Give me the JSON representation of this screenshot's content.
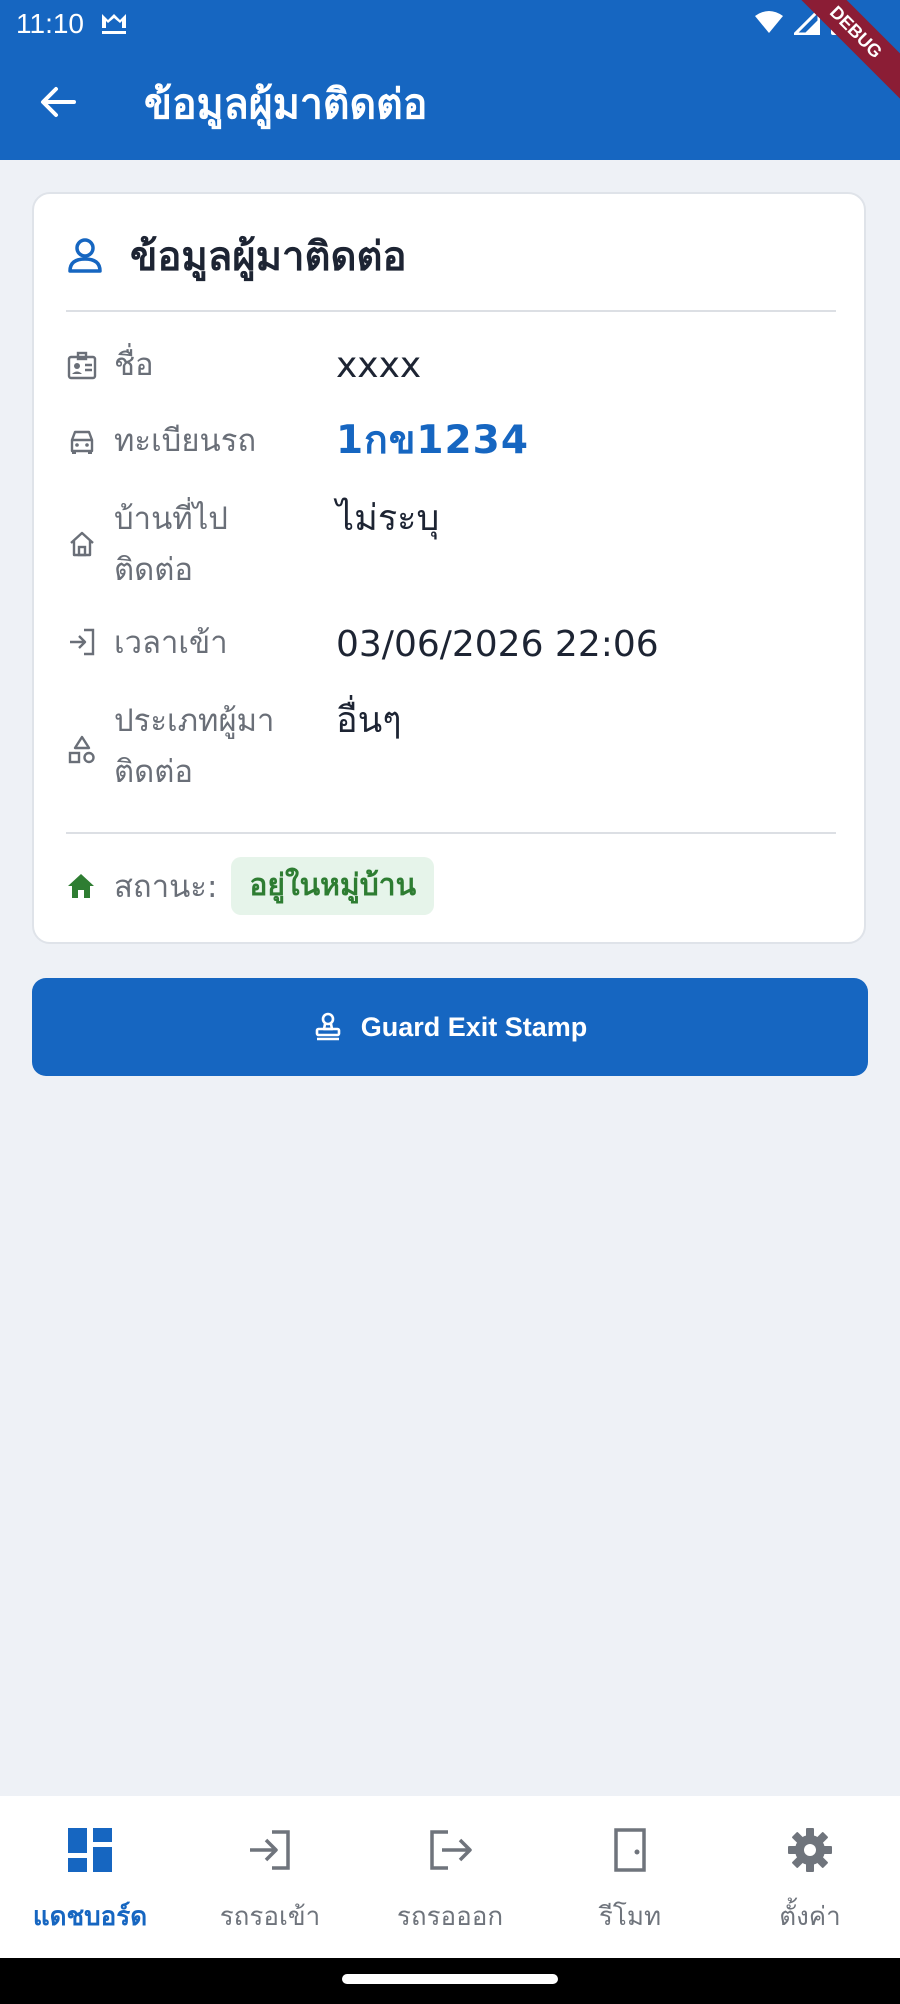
{
  "status_bar": {
    "time": "11:10"
  },
  "debug_label": "DEBUG",
  "app_bar": {
    "title": "ข้อมูลผู้มาติดต่อ"
  },
  "card": {
    "title": "ข้อมูลผู้มาติดต่อ",
    "rows": [
      {
        "label": "ชื่อ",
        "value": "xxxx",
        "icon": "id-card-icon"
      },
      {
        "label": "ทะเบียนรถ",
        "value": "1กข1234",
        "icon": "car-icon"
      },
      {
        "label": "บ้านที่ไปติดต่อ",
        "value": "ไม่ระบุ",
        "icon": "house-icon"
      },
      {
        "label": "เวลาเข้า",
        "value": "03/06/2026 22:06",
        "icon": "login-icon"
      },
      {
        "label": "ประเภทผู้มาติดต่อ",
        "value": "อื่นๆ",
        "icon": "category-icon"
      }
    ],
    "status_label": "สถานะ:",
    "status_value": "อยู่ในหมู่บ้าน"
  },
  "exit_button": {
    "label": "Guard Exit Stamp"
  },
  "bottom_nav": {
    "items": [
      {
        "label": "แดชบอร์ด",
        "icon": "dashboard-icon",
        "active": true
      },
      {
        "label": "รถรอเข้า",
        "icon": "enter-icon",
        "active": false
      },
      {
        "label": "รถรอออก",
        "icon": "exit-icon",
        "active": false
      },
      {
        "label": "รีโมท",
        "icon": "door-icon",
        "active": false
      },
      {
        "label": "ตั้งค่า",
        "icon": "gear-icon",
        "active": false
      }
    ]
  },
  "colors": {
    "primary": "#1666c1",
    "status_green": "#2e7d32",
    "status_bg": "#e6f4ea",
    "background": "#eef1f6"
  }
}
